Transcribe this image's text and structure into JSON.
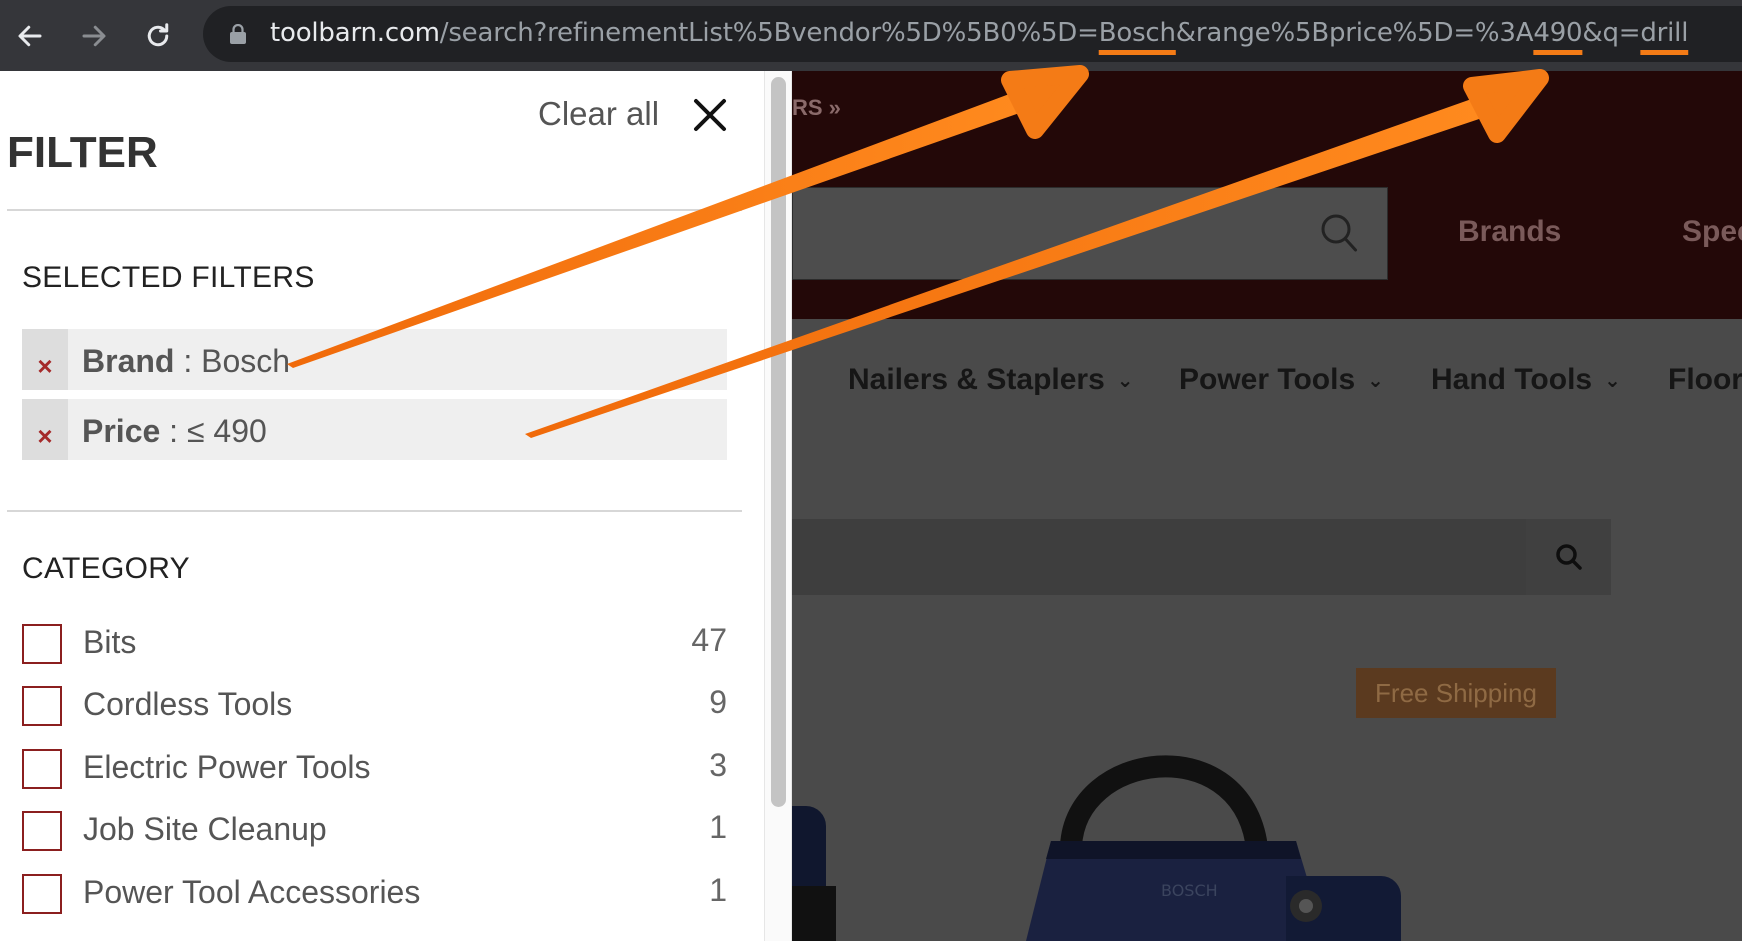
{
  "browser": {
    "back_icon": "arrow-left-icon",
    "forward_icon": "arrow-right-icon",
    "reload_icon": "reload-icon",
    "lock_icon": "lock-icon",
    "url_host": "toolbarn.com",
    "url_path_1": "/search?refinementList%5Bvendor%5D%5B0%5D=",
    "url_brand": "Bosch",
    "url_path_2": "&range%5Bprice%5D=%3A",
    "url_price": "490",
    "url_path_3": "&q=",
    "url_query": "drill"
  },
  "filter_panel": {
    "clear_all": "Clear all",
    "close_icon": "close-x-icon",
    "title": "FILTER",
    "selected_title": "SELECTED FILTERS",
    "selected_filters": [
      {
        "key": "Brand",
        "separator": " : ",
        "value": "Bosch",
        "remove": "×"
      },
      {
        "key": "Price",
        "separator": " : ",
        "value": "≤ 490",
        "remove": "×"
      }
    ],
    "category_title": "CATEGORY",
    "categories": [
      {
        "label": "Bits",
        "count": "47"
      },
      {
        "label": "Cordless Tools",
        "count": "9"
      },
      {
        "label": "Electric Power Tools",
        "count": "3"
      },
      {
        "label": "Job Site Cleanup",
        "count": "1"
      },
      {
        "label": "Power Tool Accessories",
        "count": "1"
      }
    ]
  },
  "background_page": {
    "crumb": "RS »",
    "header_links": [
      "Brands",
      "Spec"
    ],
    "nav_items": [
      "Nailers & Staplers",
      "Power Tools",
      "Hand Tools",
      "Floor"
    ],
    "nav_chevron": "⌄",
    "search_icon": "magnifier-icon",
    "badge": "Free Shipping"
  },
  "colors": {
    "accent_orange": "#f47b16",
    "remove_red": "#a52a2a",
    "checkbox_border": "#8b1f1f",
    "header_dark": "#230808"
  }
}
